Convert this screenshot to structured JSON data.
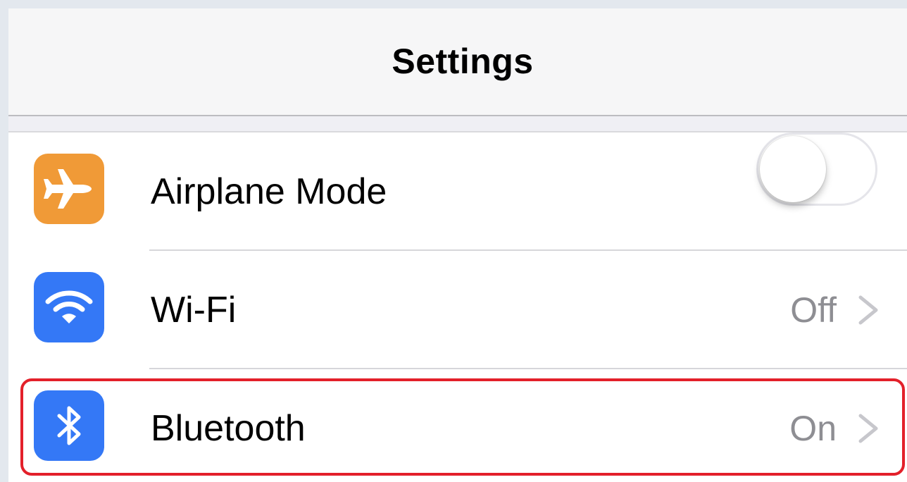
{
  "navbar": {
    "title": "Settings"
  },
  "settings": {
    "rows": [
      {
        "label": "Airplane Mode",
        "icon": "airplane-icon",
        "icon_color": "#f09a37",
        "control": "toggle",
        "toggle_on": false
      },
      {
        "label": "Wi-Fi",
        "icon": "wifi-icon",
        "icon_color": "#3478f6",
        "value": "Off",
        "control": "disclosure"
      },
      {
        "label": "Bluetooth",
        "icon": "bluetooth-icon",
        "icon_color": "#3478f6",
        "value": "On",
        "control": "disclosure"
      }
    ]
  },
  "highlight": {
    "target": "Bluetooth",
    "color": "#e3202a"
  }
}
